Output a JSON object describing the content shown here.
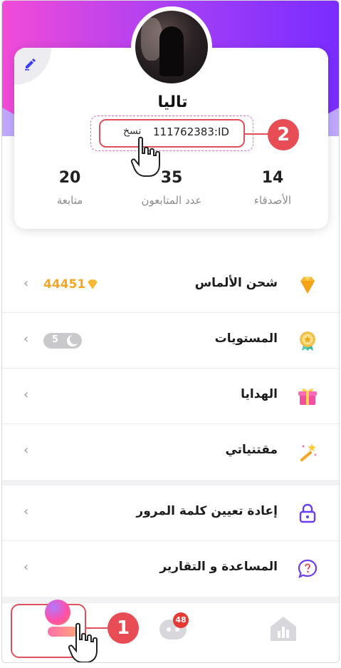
{
  "profile": {
    "name": "تاليا",
    "id_text": "111762383:ID",
    "copy_label": "نسخ"
  },
  "stats": [
    {
      "value": "20",
      "label": "متابعة"
    },
    {
      "value": "35",
      "label": "عدد المتابعون"
    },
    {
      "value": "14",
      "label": "الأصدقاء"
    }
  ],
  "menu": {
    "diamonds": {
      "label": "شحن الألماس",
      "value": "44451",
      "icon": "diamond-icon"
    },
    "levels": {
      "label": "المستويات",
      "value": "5",
      "icon": "medal-icon"
    },
    "gifts": {
      "label": "الهدايا",
      "icon": "gift-icon"
    },
    "belongings": {
      "label": "مقتنياتي",
      "icon": "magic-wand-icon"
    },
    "reset_password": {
      "label": "إعادة تعيين كلمة المرور",
      "icon": "lock-icon"
    },
    "help": {
      "label": "المساعدة و التقارير",
      "icon": "question-bubble-icon"
    }
  },
  "tabbar": {
    "messages_badge": "48"
  },
  "annotations": {
    "step1": "1",
    "step2": "2"
  },
  "colors": {
    "header_gradient_start": "#f24bd7",
    "header_gradient_end": "#7a2cff",
    "diamond_value": "#f5a623",
    "annotation_red": "#e84d55"
  }
}
